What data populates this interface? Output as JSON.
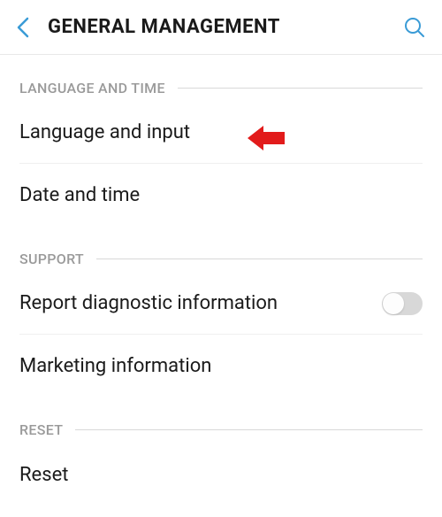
{
  "header": {
    "title": "GENERAL MANAGEMENT"
  },
  "sections": {
    "language_time": {
      "label": "LANGUAGE AND TIME",
      "items": {
        "lang_input": "Language and input",
        "date_time": "Date and time"
      }
    },
    "support": {
      "label": "SUPPORT",
      "items": {
        "diagnostic": "Report diagnostic information",
        "marketing": "Marketing information"
      }
    },
    "reset": {
      "label": "RESET",
      "items": {
        "reset": "Reset"
      }
    }
  }
}
